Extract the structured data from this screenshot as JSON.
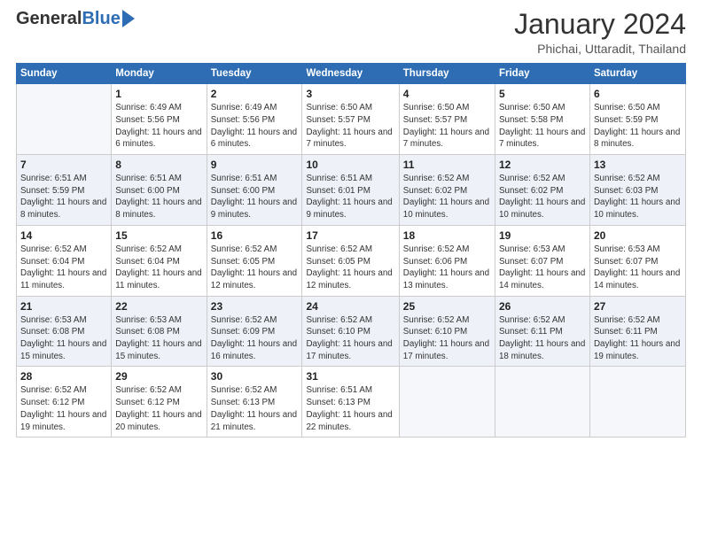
{
  "logo": {
    "general": "General",
    "blue": "Blue"
  },
  "title": {
    "month_year": "January 2024",
    "location": "Phichai, Uttaradit, Thailand"
  },
  "weekdays": [
    "Sunday",
    "Monday",
    "Tuesday",
    "Wednesday",
    "Thursday",
    "Friday",
    "Saturday"
  ],
  "weeks": [
    [
      {
        "day": "",
        "sunrise": "",
        "sunset": "",
        "daylight": ""
      },
      {
        "day": "1",
        "sunrise": "Sunrise: 6:49 AM",
        "sunset": "Sunset: 5:56 PM",
        "daylight": "Daylight: 11 hours and 6 minutes."
      },
      {
        "day": "2",
        "sunrise": "Sunrise: 6:49 AM",
        "sunset": "Sunset: 5:56 PM",
        "daylight": "Daylight: 11 hours and 6 minutes."
      },
      {
        "day": "3",
        "sunrise": "Sunrise: 6:50 AM",
        "sunset": "Sunset: 5:57 PM",
        "daylight": "Daylight: 11 hours and 7 minutes."
      },
      {
        "day": "4",
        "sunrise": "Sunrise: 6:50 AM",
        "sunset": "Sunset: 5:57 PM",
        "daylight": "Daylight: 11 hours and 7 minutes."
      },
      {
        "day": "5",
        "sunrise": "Sunrise: 6:50 AM",
        "sunset": "Sunset: 5:58 PM",
        "daylight": "Daylight: 11 hours and 7 minutes."
      },
      {
        "day": "6",
        "sunrise": "Sunrise: 6:50 AM",
        "sunset": "Sunset: 5:59 PM",
        "daylight": "Daylight: 11 hours and 8 minutes."
      }
    ],
    [
      {
        "day": "7",
        "sunrise": "Sunrise: 6:51 AM",
        "sunset": "Sunset: 5:59 PM",
        "daylight": "Daylight: 11 hours and 8 minutes."
      },
      {
        "day": "8",
        "sunrise": "Sunrise: 6:51 AM",
        "sunset": "Sunset: 6:00 PM",
        "daylight": "Daylight: 11 hours and 8 minutes."
      },
      {
        "day": "9",
        "sunrise": "Sunrise: 6:51 AM",
        "sunset": "Sunset: 6:00 PM",
        "daylight": "Daylight: 11 hours and 9 minutes."
      },
      {
        "day": "10",
        "sunrise": "Sunrise: 6:51 AM",
        "sunset": "Sunset: 6:01 PM",
        "daylight": "Daylight: 11 hours and 9 minutes."
      },
      {
        "day": "11",
        "sunrise": "Sunrise: 6:52 AM",
        "sunset": "Sunset: 6:02 PM",
        "daylight": "Daylight: 11 hours and 10 minutes."
      },
      {
        "day": "12",
        "sunrise": "Sunrise: 6:52 AM",
        "sunset": "Sunset: 6:02 PM",
        "daylight": "Daylight: 11 hours and 10 minutes."
      },
      {
        "day": "13",
        "sunrise": "Sunrise: 6:52 AM",
        "sunset": "Sunset: 6:03 PM",
        "daylight": "Daylight: 11 hours and 10 minutes."
      }
    ],
    [
      {
        "day": "14",
        "sunrise": "Sunrise: 6:52 AM",
        "sunset": "Sunset: 6:04 PM",
        "daylight": "Daylight: 11 hours and 11 minutes."
      },
      {
        "day": "15",
        "sunrise": "Sunrise: 6:52 AM",
        "sunset": "Sunset: 6:04 PM",
        "daylight": "Daylight: 11 hours and 11 minutes."
      },
      {
        "day": "16",
        "sunrise": "Sunrise: 6:52 AM",
        "sunset": "Sunset: 6:05 PM",
        "daylight": "Daylight: 11 hours and 12 minutes."
      },
      {
        "day": "17",
        "sunrise": "Sunrise: 6:52 AM",
        "sunset": "Sunset: 6:05 PM",
        "daylight": "Daylight: 11 hours and 12 minutes."
      },
      {
        "day": "18",
        "sunrise": "Sunrise: 6:52 AM",
        "sunset": "Sunset: 6:06 PM",
        "daylight": "Daylight: 11 hours and 13 minutes."
      },
      {
        "day": "19",
        "sunrise": "Sunrise: 6:53 AM",
        "sunset": "Sunset: 6:07 PM",
        "daylight": "Daylight: 11 hours and 14 minutes."
      },
      {
        "day": "20",
        "sunrise": "Sunrise: 6:53 AM",
        "sunset": "Sunset: 6:07 PM",
        "daylight": "Daylight: 11 hours and 14 minutes."
      }
    ],
    [
      {
        "day": "21",
        "sunrise": "Sunrise: 6:53 AM",
        "sunset": "Sunset: 6:08 PM",
        "daylight": "Daylight: 11 hours and 15 minutes."
      },
      {
        "day": "22",
        "sunrise": "Sunrise: 6:53 AM",
        "sunset": "Sunset: 6:08 PM",
        "daylight": "Daylight: 11 hours and 15 minutes."
      },
      {
        "day": "23",
        "sunrise": "Sunrise: 6:52 AM",
        "sunset": "Sunset: 6:09 PM",
        "daylight": "Daylight: 11 hours and 16 minutes."
      },
      {
        "day": "24",
        "sunrise": "Sunrise: 6:52 AM",
        "sunset": "Sunset: 6:10 PM",
        "daylight": "Daylight: 11 hours and 17 minutes."
      },
      {
        "day": "25",
        "sunrise": "Sunrise: 6:52 AM",
        "sunset": "Sunset: 6:10 PM",
        "daylight": "Daylight: 11 hours and 17 minutes."
      },
      {
        "day": "26",
        "sunrise": "Sunrise: 6:52 AM",
        "sunset": "Sunset: 6:11 PM",
        "daylight": "Daylight: 11 hours and 18 minutes."
      },
      {
        "day": "27",
        "sunrise": "Sunrise: 6:52 AM",
        "sunset": "Sunset: 6:11 PM",
        "daylight": "Daylight: 11 hours and 19 minutes."
      }
    ],
    [
      {
        "day": "28",
        "sunrise": "Sunrise: 6:52 AM",
        "sunset": "Sunset: 6:12 PM",
        "daylight": "Daylight: 11 hours and 19 minutes."
      },
      {
        "day": "29",
        "sunrise": "Sunrise: 6:52 AM",
        "sunset": "Sunset: 6:12 PM",
        "daylight": "Daylight: 11 hours and 20 minutes."
      },
      {
        "day": "30",
        "sunrise": "Sunrise: 6:52 AM",
        "sunset": "Sunset: 6:13 PM",
        "daylight": "Daylight: 11 hours and 21 minutes."
      },
      {
        "day": "31",
        "sunrise": "Sunrise: 6:51 AM",
        "sunset": "Sunset: 6:13 PM",
        "daylight": "Daylight: 11 hours and 22 minutes."
      },
      {
        "day": "",
        "sunrise": "",
        "sunset": "",
        "daylight": ""
      },
      {
        "day": "",
        "sunrise": "",
        "sunset": "",
        "daylight": ""
      },
      {
        "day": "",
        "sunrise": "",
        "sunset": "",
        "daylight": ""
      }
    ]
  ]
}
